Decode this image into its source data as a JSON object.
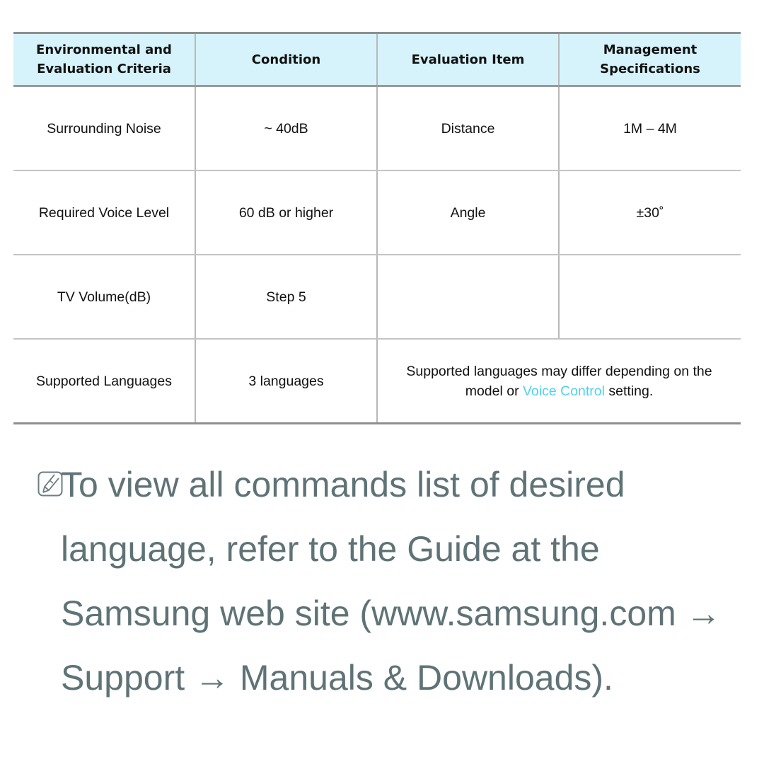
{
  "table": {
    "headers": [
      "Environmental and Evaluation Criteria",
      "Condition",
      "Evaluation Item",
      "Management Specifications"
    ],
    "rows": [
      {
        "criteria": "Surrounding Noise",
        "condition": "~ 40dB",
        "item": "Distance",
        "spec": "1M – 4M"
      },
      {
        "criteria": "Required Voice Level",
        "condition": "60 dB or higher",
        "item": "Angle",
        "spec": "±30˚"
      },
      {
        "criteria": "TV Volume(dB)",
        "condition": "Step 5",
        "item": "",
        "spec": ""
      },
      {
        "criteria": "Supported Languages",
        "condition": "3 languages",
        "note_before": "Supported languages may differ depending on the model or ",
        "note_link": "Voice Control",
        "note_after": " setting."
      }
    ]
  },
  "note": {
    "icon": "note-pencil-icon",
    "text": "To view all commands list of desired language, refer to the Guide at the Samsung web site (www.samsung.com → Support → Manuals & Downloads)."
  },
  "colors": {
    "header_bg": "#d6f3fc",
    "link": "#4fd0f5",
    "note_text": "#5f7376"
  }
}
